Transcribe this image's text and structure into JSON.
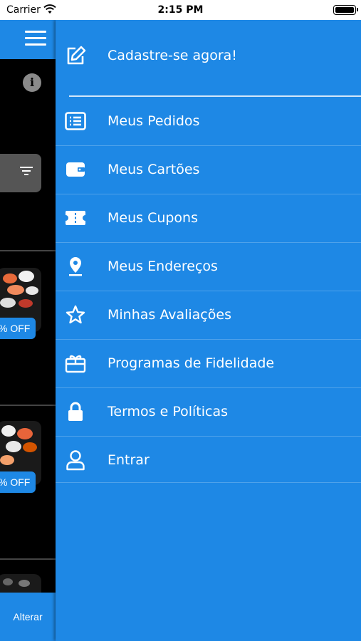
{
  "status_bar": {
    "carrier": "Carrier",
    "time": "2:15 PM"
  },
  "background_screen": {
    "badges": [
      "% OFF",
      "% OFF"
    ],
    "alter_button": "Alterar"
  },
  "drawer": {
    "header_item": {
      "label": "Cadastre-se agora!",
      "icon": "edit-icon"
    },
    "items": [
      {
        "label": "Meus Pedidos",
        "icon": "list-icon"
      },
      {
        "label": "Meus Cartões",
        "icon": "wallet-icon"
      },
      {
        "label": "Meus Cupons",
        "icon": "ticket-icon"
      },
      {
        "label": "Meus Endereços",
        "icon": "location-pin-icon"
      },
      {
        "label": "Minhas Avaliações",
        "icon": "star-icon"
      },
      {
        "label": "Programas de Fidelidade",
        "icon": "gift-icon"
      },
      {
        "label": "Termos e Políticas",
        "icon": "lock-icon"
      },
      {
        "label": "Entrar",
        "icon": "user-icon"
      }
    ]
  },
  "colors": {
    "primary": "#1e88e5",
    "background": "#000000",
    "text_on_primary": "#ffffff"
  }
}
